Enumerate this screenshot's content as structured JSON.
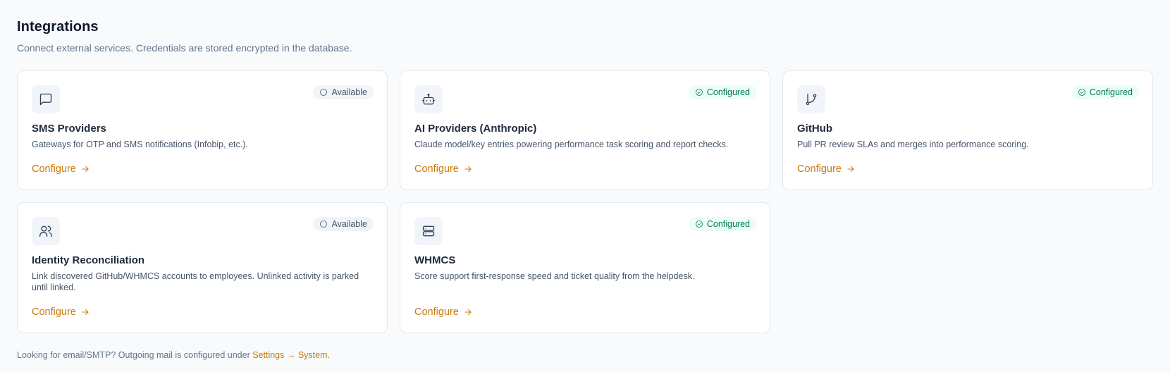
{
  "header": {
    "title": "Integrations",
    "subtitle": "Connect external services. Credentials are stored encrypted in the database."
  },
  "cards": [
    {
      "icon": "message-square-icon",
      "title": "SMS Providers",
      "description": "Gateways for OTP and SMS notifications (Infobip, etc.).",
      "status": "Available",
      "action": "Configure"
    },
    {
      "icon": "bot-icon",
      "title": "AI Providers (Anthropic)",
      "description": "Claude model/key entries powering performance task scoring and report checks.",
      "status": "Configured",
      "action": "Configure"
    },
    {
      "icon": "git-branch-icon",
      "title": "GitHub",
      "description": "Pull PR review SLAs and merges into performance scoring.",
      "status": "Configured",
      "action": "Configure"
    },
    {
      "icon": "users-icon",
      "title": "Identity Reconciliation",
      "description": "Link discovered GitHub/WHMCS accounts to employees. Unlinked activity is parked until linked.",
      "status": "Available",
      "action": "Configure"
    },
    {
      "icon": "server-icon",
      "title": "WHMCS",
      "description": "Score support first-response speed and ticket quality from the helpdesk.",
      "status": "Configured",
      "action": "Configure"
    }
  ],
  "footer": {
    "text": "Looking for email/SMTP? Outgoing mail is configured under ",
    "link": "Settings → System",
    "end": "."
  },
  "colors": {
    "accent": "#c77a0a",
    "configured": "#047857",
    "available": "#475569"
  }
}
